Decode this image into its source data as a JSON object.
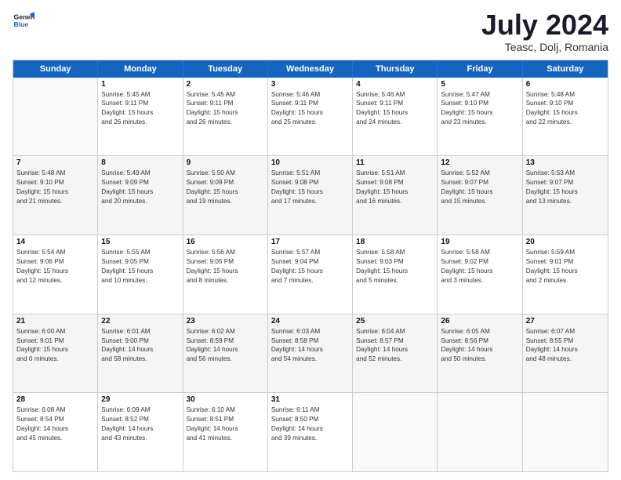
{
  "header": {
    "logo_line1": "General",
    "logo_line2": "Blue",
    "month_title": "July 2024",
    "location": "Teasc, Dolj, Romania"
  },
  "calendar": {
    "days_of_week": [
      "Sunday",
      "Monday",
      "Tuesday",
      "Wednesday",
      "Thursday",
      "Friday",
      "Saturday"
    ],
    "rows": [
      [
        {
          "day": "",
          "text": ""
        },
        {
          "day": "1",
          "text": "Sunrise: 5:45 AM\nSunset: 9:11 PM\nDaylight: 15 hours\nand 26 minutes."
        },
        {
          "day": "2",
          "text": "Sunrise: 5:45 AM\nSunset: 9:11 PM\nDaylight: 15 hours\nand 26 minutes."
        },
        {
          "day": "3",
          "text": "Sunrise: 5:46 AM\nSunset: 9:11 PM\nDaylight: 15 hours\nand 25 minutes."
        },
        {
          "day": "4",
          "text": "Sunrise: 5:46 AM\nSunset: 9:11 PM\nDaylight: 15 hours\nand 24 minutes."
        },
        {
          "day": "5",
          "text": "Sunrise: 5:47 AM\nSunset: 9:10 PM\nDaylight: 15 hours\nand 23 minutes."
        },
        {
          "day": "6",
          "text": "Sunrise: 5:48 AM\nSunset: 9:10 PM\nDaylight: 15 hours\nand 22 minutes."
        }
      ],
      [
        {
          "day": "7",
          "text": "Sunrise: 5:48 AM\nSunset: 9:10 PM\nDaylight: 15 hours\nand 21 minutes."
        },
        {
          "day": "8",
          "text": "Sunrise: 5:49 AM\nSunset: 9:09 PM\nDaylight: 15 hours\nand 20 minutes."
        },
        {
          "day": "9",
          "text": "Sunrise: 5:50 AM\nSunset: 9:09 PM\nDaylight: 15 hours\nand 19 minutes."
        },
        {
          "day": "10",
          "text": "Sunrise: 5:51 AM\nSunset: 9:08 PM\nDaylight: 15 hours\nand 17 minutes."
        },
        {
          "day": "11",
          "text": "Sunrise: 5:51 AM\nSunset: 9:08 PM\nDaylight: 15 hours\nand 16 minutes."
        },
        {
          "day": "12",
          "text": "Sunrise: 5:52 AM\nSunset: 9:07 PM\nDaylight: 15 hours\nand 15 minutes."
        },
        {
          "day": "13",
          "text": "Sunrise: 5:53 AM\nSunset: 9:07 PM\nDaylight: 15 hours\nand 13 minutes."
        }
      ],
      [
        {
          "day": "14",
          "text": "Sunrise: 5:54 AM\nSunset: 9:06 PM\nDaylight: 15 hours\nand 12 minutes."
        },
        {
          "day": "15",
          "text": "Sunrise: 5:55 AM\nSunset: 9:05 PM\nDaylight: 15 hours\nand 10 minutes."
        },
        {
          "day": "16",
          "text": "Sunrise: 5:56 AM\nSunset: 9:05 PM\nDaylight: 15 hours\nand 8 minutes."
        },
        {
          "day": "17",
          "text": "Sunrise: 5:57 AM\nSunset: 9:04 PM\nDaylight: 15 hours\nand 7 minutes."
        },
        {
          "day": "18",
          "text": "Sunrise: 5:58 AM\nSunset: 9:03 PM\nDaylight: 15 hours\nand 5 minutes."
        },
        {
          "day": "19",
          "text": "Sunrise: 5:58 AM\nSunset: 9:02 PM\nDaylight: 15 hours\nand 3 minutes."
        },
        {
          "day": "20",
          "text": "Sunrise: 5:59 AM\nSunset: 9:01 PM\nDaylight: 15 hours\nand 2 minutes."
        }
      ],
      [
        {
          "day": "21",
          "text": "Sunrise: 6:00 AM\nSunset: 9:01 PM\nDaylight: 15 hours\nand 0 minutes."
        },
        {
          "day": "22",
          "text": "Sunrise: 6:01 AM\nSunset: 9:00 PM\nDaylight: 14 hours\nand 58 minutes."
        },
        {
          "day": "23",
          "text": "Sunrise: 6:02 AM\nSunset: 8:59 PM\nDaylight: 14 hours\nand 56 minutes."
        },
        {
          "day": "24",
          "text": "Sunrise: 6:03 AM\nSunset: 8:58 PM\nDaylight: 14 hours\nand 54 minutes."
        },
        {
          "day": "25",
          "text": "Sunrise: 6:04 AM\nSunset: 8:57 PM\nDaylight: 14 hours\nand 52 minutes."
        },
        {
          "day": "26",
          "text": "Sunrise: 6:05 AM\nSunset: 8:56 PM\nDaylight: 14 hours\nand 50 minutes."
        },
        {
          "day": "27",
          "text": "Sunrise: 6:07 AM\nSunset: 8:55 PM\nDaylight: 14 hours\nand 48 minutes."
        }
      ],
      [
        {
          "day": "28",
          "text": "Sunrise: 6:08 AM\nSunset: 8:54 PM\nDaylight: 14 hours\nand 45 minutes."
        },
        {
          "day": "29",
          "text": "Sunrise: 6:09 AM\nSunset: 8:52 PM\nDaylight: 14 hours\nand 43 minutes."
        },
        {
          "day": "30",
          "text": "Sunrise: 6:10 AM\nSunset: 8:51 PM\nDaylight: 14 hours\nand 41 minutes."
        },
        {
          "day": "31",
          "text": "Sunrise: 6:11 AM\nSunset: 8:50 PM\nDaylight: 14 hours\nand 39 minutes."
        },
        {
          "day": "",
          "text": ""
        },
        {
          "day": "",
          "text": ""
        },
        {
          "day": "",
          "text": ""
        }
      ]
    ]
  }
}
